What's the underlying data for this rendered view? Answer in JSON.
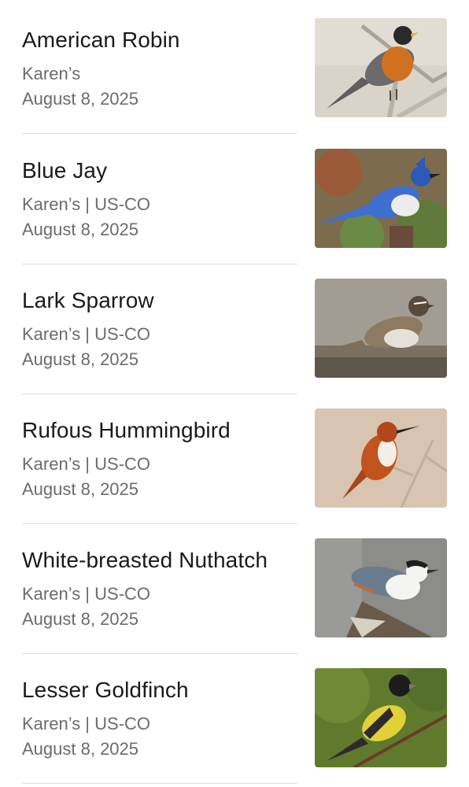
{
  "sightings": [
    {
      "name": "American Robin",
      "location": "Karen’s",
      "date": "August 8, 2025",
      "photo_icon": "american-robin-photo",
      "colors": {
        "bg": "#d9d4c9",
        "body": "#6c6a6a",
        "accent": "#d1711f",
        "head": "#2a2a2a"
      }
    },
    {
      "name": "Blue Jay",
      "location": "Karen’s | US-CO",
      "date": "August 8, 2025",
      "photo_icon": "blue-jay-photo",
      "colors": {
        "bg": "#7d6b4e",
        "body": "#3e6fd0",
        "accent": "#ececec",
        "head": "#2d59b8"
      }
    },
    {
      "name": "Lark Sparrow",
      "location": "Karen’s | US-CO",
      "date": "August 8, 2025",
      "photo_icon": "lark-sparrow-photo",
      "colors": {
        "bg": "#a39c93",
        "body": "#8c7b62",
        "accent": "#e6e1d8",
        "head": "#5a4a3a"
      }
    },
    {
      "name": "Rufous Hummingbird",
      "location": "Karen’s | US-CO",
      "date": "August 8, 2025",
      "photo_icon": "rufous-hummingbird-photo",
      "colors": {
        "bg": "#d8c4b1",
        "body": "#c0541c",
        "accent": "#f4eee6",
        "head": "#b3461a"
      }
    },
    {
      "name": "White-breasted Nuthatch",
      "location": "Karen’s | US-CO",
      "date": "August 8, 2025",
      "photo_icon": "white-breasted-nuthatch-photo",
      "colors": {
        "bg": "#8c8c89",
        "body": "#6b7b8e",
        "accent": "#f4f4f2",
        "head": "#1e1e1e"
      }
    },
    {
      "name": "Lesser Goldfinch",
      "location": "Karen’s | US-CO",
      "date": "August 8, 2025",
      "photo_icon": "lesser-goldfinch-photo",
      "colors": {
        "bg": "#5f7a2c",
        "body": "#e2d136",
        "accent": "#2b2b2b",
        "head": "#1c1c1c"
      }
    }
  ]
}
